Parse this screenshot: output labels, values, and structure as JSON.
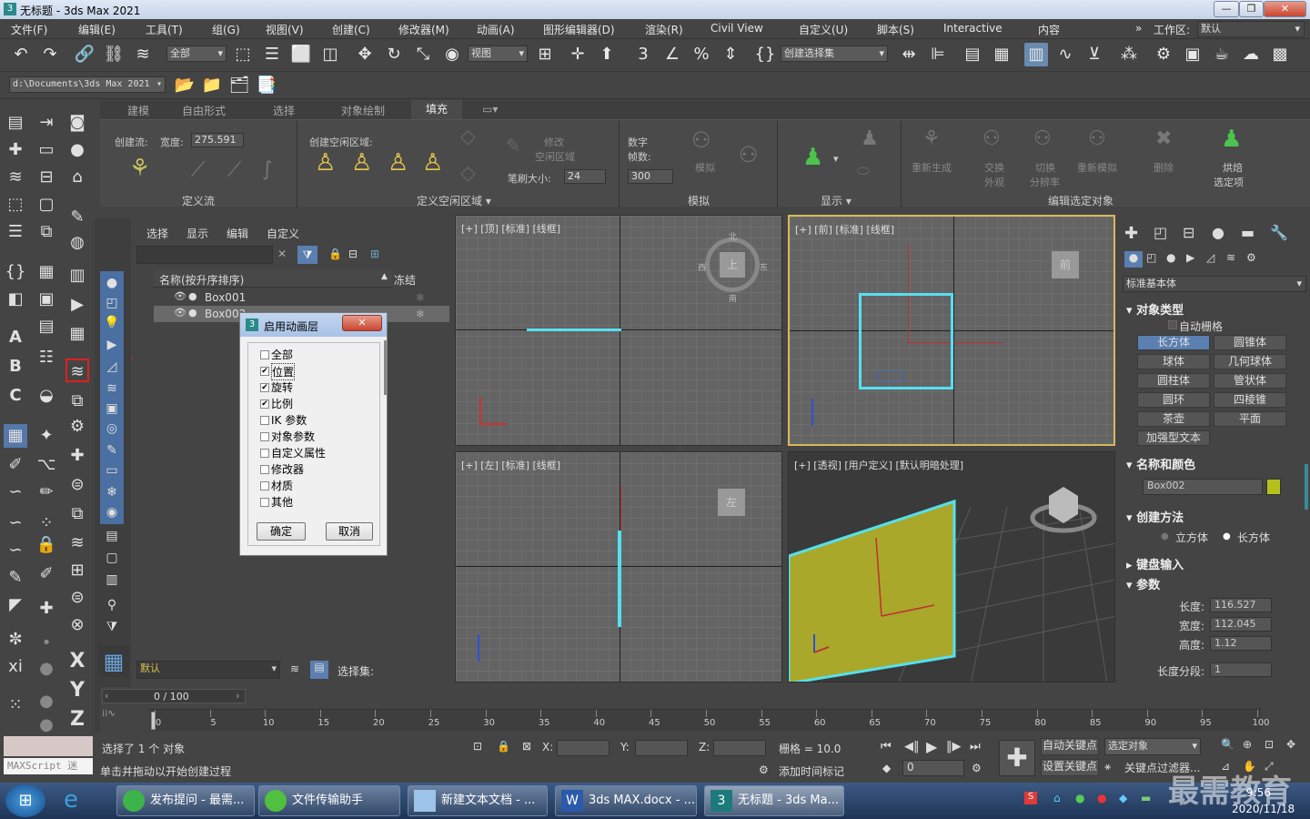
{
  "window": {
    "title": "无标题 - 3ds Max 2021"
  },
  "menu": [
    "文件(F)",
    "编辑(E)",
    "工具(T)",
    "组(G)",
    "视图(V)",
    "创建(C)",
    "修改器(M)",
    "动画(A)",
    "图形编辑器(D)",
    "渲染(R)",
    "Civil View",
    "自定义(U)",
    "脚本(S)",
    "Interactive",
    "内容"
  ],
  "workspace": {
    "label": "工作区:",
    "value": "默认"
  },
  "toolbar": {
    "filter": "全部",
    "refcoord": "视图",
    "selset": "创建选择集"
  },
  "path": "d:\\Documents\\3ds Max 2021",
  "ribbon": {
    "tabs": [
      "建模",
      "自由形式",
      "选择",
      "对象绘制",
      "填充"
    ],
    "active_tab": "填充",
    "groups": {
      "define_flow": {
        "footer": "定义流",
        "label": "创建流:",
        "width_label": "宽度:",
        "width": "275.591"
      },
      "define_idle": {
        "footer": "定义空闲区域",
        "label": "创建空闲区域:",
        "modify": "修改",
        "modify2": "空闲区域",
        "brush_label": "笔刷大小:",
        "brush": "24"
      },
      "simulate": {
        "footer": "模拟",
        "frames_label": "数字",
        "frames_label2": "帧数:",
        "frames": "300",
        "sim": "模拟"
      },
      "display": {
        "footer": "显示"
      },
      "edit_selected": {
        "footer": "编辑选定对象",
        "regen": "重新生成",
        "swap1": "交换",
        "swap2": "外观",
        "switch1": "切换",
        "switch2": "分辨率",
        "resim": "重新模拟",
        "delete": "删除",
        "bake1": "烘焙",
        "bake2": "选定项"
      }
    }
  },
  "scene_explorer": {
    "menu": [
      "选择",
      "显示",
      "编辑",
      "自定义"
    ],
    "col_name": "名称(按升序排序)",
    "col_frozen": "冻结",
    "rows": [
      "Box001",
      "Box002"
    ],
    "layer": "默认",
    "selset_label": "选择集:"
  },
  "dialog": {
    "title": "启用动画层",
    "items": [
      {
        "label": "全部",
        "checked": false
      },
      {
        "label": "位置",
        "checked": true
      },
      {
        "label": "旋转",
        "checked": true
      },
      {
        "label": "比例",
        "checked": true
      },
      {
        "label": "IK 参数",
        "checked": false
      },
      {
        "label": "对象参数",
        "checked": false
      },
      {
        "label": "自定义属性",
        "checked": false
      },
      {
        "label": "修改器",
        "checked": false
      },
      {
        "label": "材质",
        "checked": false
      },
      {
        "label": "其他",
        "checked": false
      }
    ],
    "ok": "确定",
    "cancel": "取消"
  },
  "viewports": {
    "top": "[+] [顶] [标准] [线框]",
    "front": "[+] [前] [标准] [线框]",
    "left": "[+] [左] [标准] [线框]",
    "persp": "[+] [透视] [用户定义] [默认明暗处理]",
    "cube_top": "上",
    "cube_front": "前",
    "cube_left": "左",
    "compass": [
      "北",
      "东",
      "南",
      "西"
    ]
  },
  "command_panel": {
    "category": "标准基本体",
    "object_type": "对象类型",
    "autogrid": "自动栅格",
    "buttons": [
      "长方体",
      "圆锥体",
      "球体",
      "几何球体",
      "圆柱体",
      "管状体",
      "圆环",
      "四棱锥",
      "茶壶",
      "平面",
      "加强型文本"
    ],
    "name_color": "名称和颜色",
    "name": "Box002",
    "creation_method": "创建方法",
    "cube": "立方体",
    "box": "长方体",
    "keyboard": "键盘输入",
    "params": "参数",
    "length_label": "长度:",
    "length": "116.527",
    "width_label": "宽度:",
    "width": "112.045",
    "height_label": "高度:",
    "height": "1.12",
    "segs_label": "长度分段:",
    "segs": "1",
    "color": "#b5c11a"
  },
  "timeline": {
    "frame": "0 / 100",
    "ticks": [
      "0",
      "5",
      "10",
      "15",
      "20",
      "25",
      "30",
      "35",
      "40",
      "45",
      "50",
      "55",
      "60",
      "65",
      "70",
      "75",
      "80",
      "85",
      "90",
      "95",
      "100"
    ]
  },
  "status": {
    "maxscript": "MAXScript 迷",
    "sel": "选择了 1 个 对象",
    "prompt": "单击并拖动以开始创建过程",
    "x": "X:",
    "y": "Y:",
    "z": "Z:",
    "grid": "栅格 = 10.0",
    "add_tag": "添加时间标记",
    "autokey": "自动关键点",
    "setkey": "设置关键点",
    "selobj": "选定对象",
    "keyfilter": "关键点过滤器...",
    "frame": "0"
  },
  "taskbar": {
    "tasks": [
      "发布提问 - 最需...",
      "文件传输助手",
      "新建文本文档 - ...",
      "3ds MAX.docx - ...",
      "无标题 - 3ds Ma..."
    ],
    "time": "9:56",
    "date": "2020/11/18",
    "watermark": "最需教育"
  }
}
